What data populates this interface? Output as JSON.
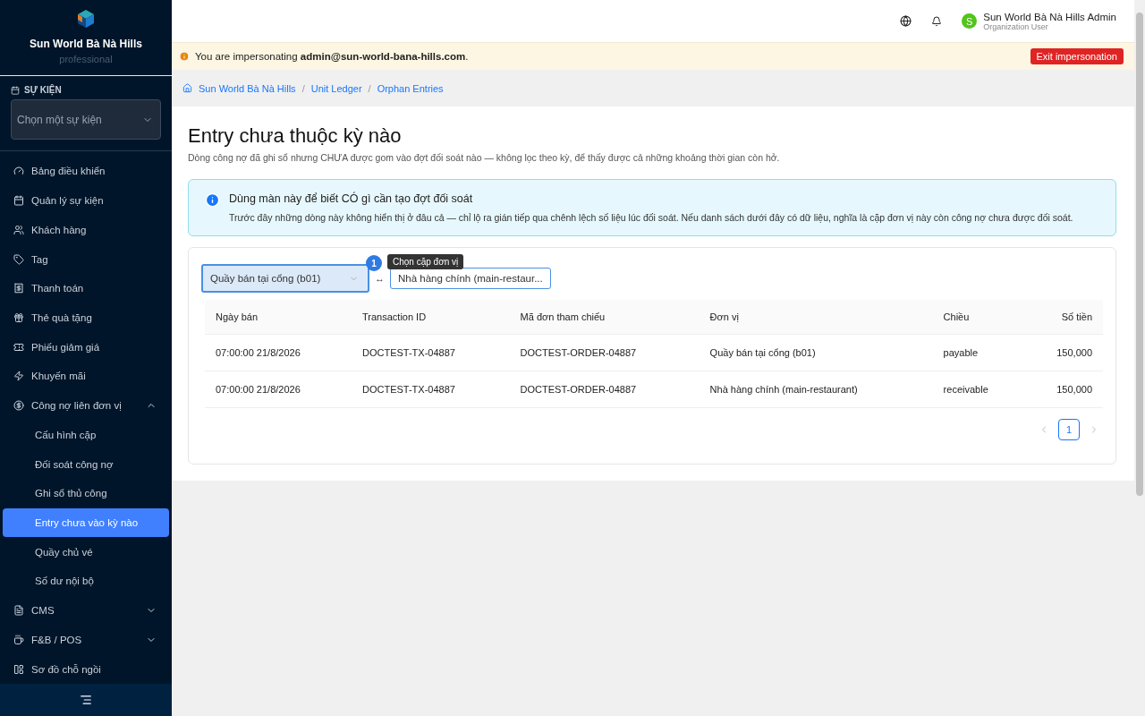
{
  "brand": {
    "name": "Sun World Bà Nà Hills",
    "plan": "professional"
  },
  "event_picker": {
    "label": "SỰ KIỆN",
    "placeholder": "Chọn một sự kiện"
  },
  "nav": [
    {
      "label": "Bảng điều khiển",
      "selected": false
    },
    {
      "label": "Quản lý sự kiện",
      "selected": false
    },
    {
      "label": "Khách hàng",
      "selected": false
    },
    {
      "label": "Tag",
      "selected": false
    },
    {
      "label": "Thanh toán",
      "selected": false
    },
    {
      "label": "Thẻ quà tặng",
      "selected": false
    },
    {
      "label": "Phiếu giảm giá",
      "selected": false
    },
    {
      "label": "Khuyến mãi",
      "selected": false
    },
    {
      "label": "Công nợ liên đơn vị",
      "selected": false,
      "expanded": true,
      "children": [
        {
          "label": "Cấu hình cặp",
          "selected": false
        },
        {
          "label": "Đối soát công nợ",
          "selected": false
        },
        {
          "label": "Ghi sổ thủ công",
          "selected": false
        },
        {
          "label": "Entry chưa vào kỳ nào",
          "selected": true
        },
        {
          "label": "Quầy chủ vé",
          "selected": false
        },
        {
          "label": "Số dư nội bộ",
          "selected": false
        }
      ]
    },
    {
      "label": "CMS",
      "selected": false,
      "expanded": false
    },
    {
      "label": "F&B / POS",
      "selected": false,
      "expanded": false
    },
    {
      "label": "Sơ đồ chỗ ngồi",
      "selected": false
    }
  ],
  "user": {
    "initial": "S",
    "name": "Sun World Bà Nà Hills Admin",
    "role": "Organization User"
  },
  "impersonation": {
    "prefix": "You are impersonating ",
    "email": "admin@sun-world-bana-hills.com",
    "suffix": ".",
    "button": "Exit impersonation"
  },
  "breadcrumb": {
    "separator": "/",
    "items": [
      "Sun World Bà Nà Hills",
      "Unit Ledger",
      "Orphan Entries"
    ]
  },
  "page": {
    "title": "Entry chưa thuộc kỳ nào",
    "subtitle": "Dòng công nợ đã ghi sổ nhưng CHƯA được gom vào đợt đối soát nào — không lọc theo kỳ, để thấy được cả những khoảng thời gian còn hở."
  },
  "info": {
    "title": "Dùng màn này để biết CÓ gì cần tạo đợt đối soát",
    "body": "Trước đây những dòng này không hiển thị ở đâu cả — chỉ lộ ra gián tiếp qua chênh lệch số liệu lúc đối soát. Nếu danh sách dưới đây có dữ liệu, nghĩa là cặp đơn vị này còn công nợ chưa được đối soát."
  },
  "filters": {
    "unit_a": "Quầy bán tại cổng (b01)",
    "separator": "↔",
    "unit_b": "Nhà hàng chính (main-restaur...",
    "tour_step": "1",
    "tooltip": "Chọn cặp đơn vị"
  },
  "table": {
    "columns": [
      "Ngày bán",
      "Transaction ID",
      "Mã đơn tham chiếu",
      "Đơn vị",
      "Chiều",
      "Số tiền"
    ],
    "rows": [
      [
        "07:00:00 21/8/2026",
        "DOCTEST-TX-04887",
        "DOCTEST-ORDER-04887",
        "Quầy bán tại cổng (b01)",
        "payable",
        "150,000"
      ],
      [
        "07:00:00 21/8/2026",
        "DOCTEST-TX-04887",
        "DOCTEST-ORDER-04887",
        "Nhà hàng chính (main-restaurant)",
        "receivable",
        "150,000"
      ]
    ]
  },
  "pagination": {
    "pages": [
      {
        "label": "1",
        "selected": true
      }
    ]
  }
}
